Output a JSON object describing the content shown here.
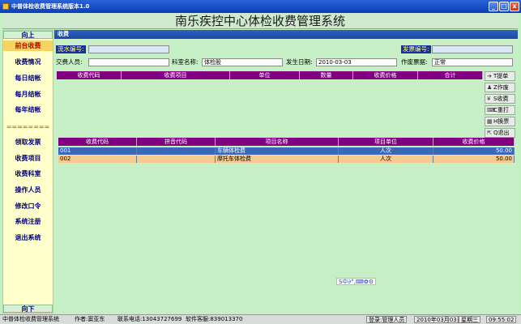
{
  "window": {
    "title": "中普体检收费管理系统版本1.0",
    "min": "_",
    "max": "□",
    "close": "x"
  },
  "banner": {
    "title": "南乐疾控中心体检收费管理系统"
  },
  "sidebar": {
    "up": "向上",
    "down": "向下",
    "items": [
      {
        "label": "前台收费"
      },
      {
        "label": "收费情况"
      },
      {
        "label": "每日结帐"
      },
      {
        "label": "每月结帐"
      },
      {
        "label": "每年结帐"
      },
      {
        "label": "========"
      },
      {
        "label": "领取发票"
      },
      {
        "label": "收费项目"
      },
      {
        "label": "收费科室"
      },
      {
        "label": "操作人员"
      },
      {
        "label": "修改口令"
      },
      {
        "label": "系统注册"
      },
      {
        "label": "退出系统"
      }
    ]
  },
  "panel": {
    "title": "收费"
  },
  "form": {
    "serial_label": "流水编号:",
    "serial_value": "",
    "invoice_label": "发票编号:",
    "invoice_value": "",
    "payer_label": "交费人员:",
    "payer_value": "",
    "dept_label": "科室名称:",
    "dept_value": "体检股",
    "date_label": "发生日期:",
    "date_value": "2010-03-03",
    "void_label": "作废票据:",
    "void_value": "正常"
  },
  "fee_grid": {
    "headers": [
      "收费代码",
      "收费项目",
      "单位",
      "数量",
      "收费价格",
      "合计"
    ],
    "rows": []
  },
  "toolbar": [
    {
      "icon": "➔",
      "label": "T提单"
    },
    {
      "icon": "♟",
      "label": "Z作废"
    },
    {
      "icon": "¥",
      "label": "S收费"
    },
    {
      "icon": "⌨",
      "label": "C重打"
    },
    {
      "icon": "▦",
      "label": "H换票"
    },
    {
      "icon": "⇱",
      "label": "Q退出"
    }
  ],
  "item_grid": {
    "headers": [
      "收费代码",
      "拼音代码",
      "项目名称",
      "项目单位",
      "收费价格"
    ],
    "rows": [
      {
        "code": "001",
        "pinyin": "",
        "name": "车辆体检费",
        "unit": "人次",
        "price": "50.00"
      },
      {
        "code": "002",
        "pinyin": "",
        "name": "摩托车体检费",
        "unit": "人次",
        "price": "50.00"
      }
    ]
  },
  "ime": {
    "text": "S中∂°,⌨✿⚙"
  },
  "status": {
    "system": "中普体检收费管理系统",
    "author": "作者:窦亚东",
    "phone": "联系电话:13043727699",
    "qq": "软件客服:839013370",
    "login": "登录:管理人员",
    "date": "2010年03月03日",
    "weekday": "星期三",
    "time": "09:55:02"
  }
}
